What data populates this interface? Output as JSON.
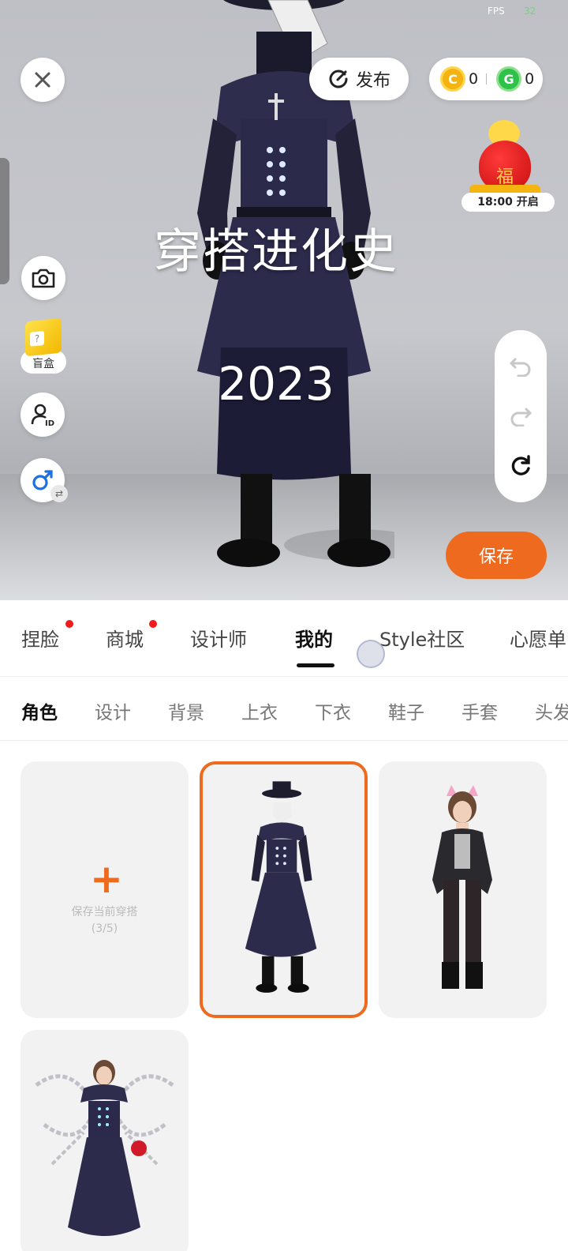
{
  "status": {
    "fps_label": "FPS",
    "fps_value": "32"
  },
  "scene": {
    "overlay_title": "穿搭进化史",
    "overlay_year": "2023",
    "publish_label": "发布",
    "coins": {
      "gold": "0",
      "green": "0"
    },
    "fortune_label": "18:00 开启",
    "fortune_char": "福",
    "blindbox_label": "盲盒",
    "save_label": "保存"
  },
  "tabs": [
    {
      "label": "捏脸",
      "dot": true
    },
    {
      "label": "商城",
      "dot": true
    },
    {
      "label": "设计师",
      "dot": false
    },
    {
      "label": "我的",
      "dot": false,
      "active": true
    },
    {
      "label": "Style社区",
      "dot": false
    },
    {
      "label": "心愿单",
      "dot": false
    }
  ],
  "subtabs": [
    {
      "label": "角色",
      "active": true
    },
    {
      "label": "设计"
    },
    {
      "label": "背景"
    },
    {
      "label": "上衣"
    },
    {
      "label": "下衣"
    },
    {
      "label": "鞋子"
    },
    {
      "label": "手套"
    },
    {
      "label": "头发"
    }
  ],
  "grid": {
    "add_card": {
      "label": "保存当前穿搭",
      "count": "(3/5)"
    },
    "outfits": [
      {
        "name": "plague-doctor-outfit",
        "selected": true
      },
      {
        "name": "cat-ear-hoodie-outfit",
        "selected": false
      },
      {
        "name": "chain-wings-outfit",
        "selected": false
      }
    ]
  },
  "colors": {
    "accent": "#ed6a1f",
    "red_dot": "#f21b1b",
    "coat": "#2b2a4a"
  }
}
